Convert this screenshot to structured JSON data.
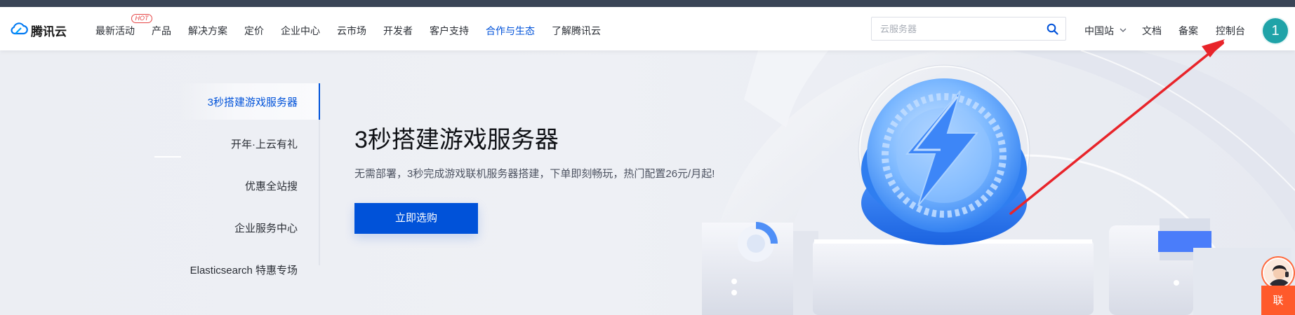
{
  "header": {
    "brand": "腾讯云",
    "hot_badge": "HOT",
    "nav": [
      {
        "label": "最新活动"
      },
      {
        "label": "产品"
      },
      {
        "label": "解决方案"
      },
      {
        "label": "定价"
      },
      {
        "label": "企业中心"
      },
      {
        "label": "云市场"
      },
      {
        "label": "开发者"
      },
      {
        "label": "客户支持"
      },
      {
        "label": "合作与生态"
      },
      {
        "label": "了解腾讯云"
      }
    ],
    "search_placeholder": "云服务器",
    "region": "中国站",
    "docs": "文档",
    "beian": "备案",
    "console": "控制台",
    "avatar_initial": "1"
  },
  "hero": {
    "side_menu": [
      {
        "label": "3秒搭建游戏服务器"
      },
      {
        "label": "开年·上云有礼"
      },
      {
        "label": "优惠全站搜"
      },
      {
        "label": "企业服务中心"
      },
      {
        "label": "Elasticsearch 特惠专场"
      }
    ],
    "title": "3秒搭建游戏服务器",
    "description": "无需部署，3秒完成游戏联机服务器搭建，下单即刻畅玩，热门配置26元/月起!",
    "cta": "立即选购"
  },
  "float": {
    "contact_label": "联"
  },
  "colors": {
    "accent": "#0052d9",
    "hot": "#e54545",
    "annotation_arrow": "#e8242a",
    "contact": "#ff5a2b"
  }
}
